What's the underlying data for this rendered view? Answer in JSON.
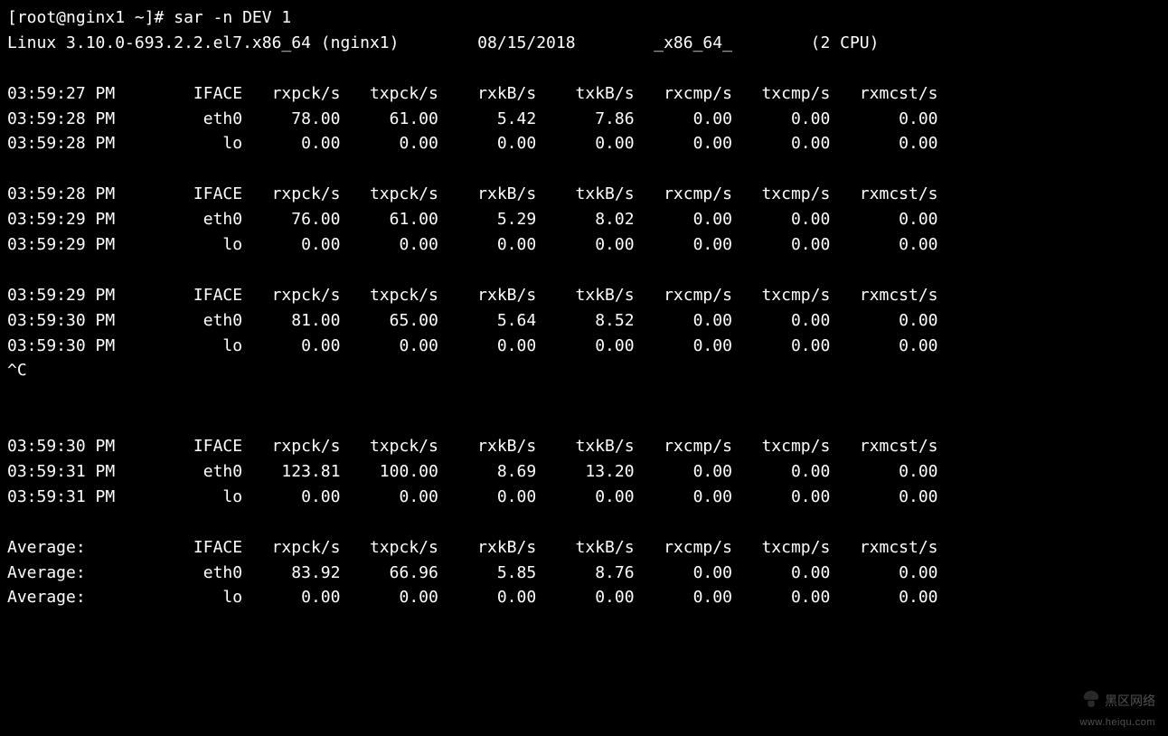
{
  "prompt": "[root@nginx1 ~]# ",
  "command": "sar -n DEV 1",
  "sys_line": {
    "kernel": "Linux 3.10.0-693.2.2.el7.x86_64 (nginx1)",
    "date": "08/15/2018",
    "arch": "_x86_64_",
    "cpu": "(2 CPU)"
  },
  "columns": [
    "IFACE",
    "rxpck/s",
    "txpck/s",
    "rxkB/s",
    "txkB/s",
    "rxcmp/s",
    "txcmp/s",
    "rxmcst/s"
  ],
  "blocks": [
    {
      "time": "03:59:27 PM",
      "rows": [
        {
          "time": "03:59:28 PM",
          "iface": "eth0",
          "rxpck": "78.00",
          "txpck": "61.00",
          "rxk": "5.42",
          "txk": "7.86",
          "rxc": "0.00",
          "txc": "0.00",
          "mc": "0.00"
        },
        {
          "time": "03:59:28 PM",
          "iface": "lo",
          "rxpck": "0.00",
          "txpck": "0.00",
          "rxk": "0.00",
          "txk": "0.00",
          "rxc": "0.00",
          "txc": "0.00",
          "mc": "0.00"
        }
      ]
    },
    {
      "time": "03:59:28 PM",
      "rows": [
        {
          "time": "03:59:29 PM",
          "iface": "eth0",
          "rxpck": "76.00",
          "txpck": "61.00",
          "rxk": "5.29",
          "txk": "8.02",
          "rxc": "0.00",
          "txc": "0.00",
          "mc": "0.00"
        },
        {
          "time": "03:59:29 PM",
          "iface": "lo",
          "rxpck": "0.00",
          "txpck": "0.00",
          "rxk": "0.00",
          "txk": "0.00",
          "rxc": "0.00",
          "txc": "0.00",
          "mc": "0.00"
        }
      ]
    },
    {
      "time": "03:59:29 PM",
      "rows": [
        {
          "time": "03:59:30 PM",
          "iface": "eth0",
          "rxpck": "81.00",
          "txpck": "65.00",
          "rxk": "5.64",
          "txk": "8.52",
          "rxc": "0.00",
          "txc": "0.00",
          "mc": "0.00"
        },
        {
          "time": "03:59:30 PM",
          "iface": "lo",
          "rxpck": "0.00",
          "txpck": "0.00",
          "rxk": "0.00",
          "txk": "0.00",
          "rxc": "0.00",
          "txc": "0.00",
          "mc": "0.00"
        }
      ],
      "after": "^C\n\n"
    },
    {
      "time": "03:59:30 PM",
      "rows": [
        {
          "time": "03:59:31 PM",
          "iface": "eth0",
          "rxpck": "123.81",
          "txpck": "100.00",
          "rxk": "8.69",
          "txk": "13.20",
          "rxc": "0.00",
          "txc": "0.00",
          "mc": "0.00"
        },
        {
          "time": "03:59:31 PM",
          "iface": "lo",
          "rxpck": "0.00",
          "txpck": "0.00",
          "rxk": "0.00",
          "txk": "0.00",
          "rxc": "0.00",
          "txc": "0.00",
          "mc": "0.00"
        }
      ]
    },
    {
      "time": "Average:   ",
      "rows": [
        {
          "time": "Average:   ",
          "iface": "eth0",
          "rxpck": "83.92",
          "txpck": "66.96",
          "rxk": "5.85",
          "txk": "8.76",
          "rxc": "0.00",
          "txc": "0.00",
          "mc": "0.00"
        },
        {
          "time": "Average:   ",
          "iface": "lo",
          "rxpck": "0.00",
          "txpck": "0.00",
          "rxk": "0.00",
          "txk": "0.00",
          "rxc": "0.00",
          "txc": "0.00",
          "mc": "0.00"
        }
      ]
    }
  ],
  "watermark": {
    "line1": "黑区网络",
    "line2": "www.heiqu.com"
  }
}
